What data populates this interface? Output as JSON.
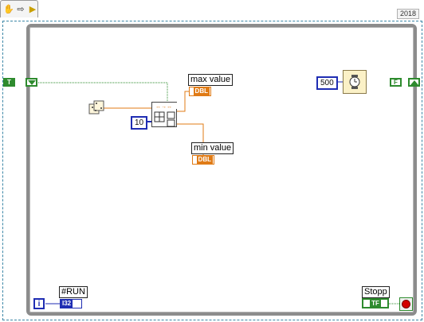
{
  "toolbar": {
    "icons": [
      "hand-icon",
      "arrow-icon",
      "run-icon"
    ],
    "glyphs": [
      "✋",
      "⇨",
      "▶"
    ]
  },
  "version": "2018",
  "tunnels": {
    "left_value": "T",
    "right_value": "F"
  },
  "indicators": {
    "max_label": "max value",
    "min_label": "min value",
    "dbl": "DBL"
  },
  "constants": {
    "array_size": "10",
    "wait_ms": "500"
  },
  "run": {
    "label": "#RUN",
    "type": "I32",
    "iteration": "i"
  },
  "stop": {
    "label": "Stopp",
    "type": "TF"
  },
  "colors": {
    "boolean": "#2e8b2e",
    "numeric_int": "#1f2db3",
    "numeric_dbl": "#e07b16",
    "loop_border": "#8c8c8c"
  }
}
